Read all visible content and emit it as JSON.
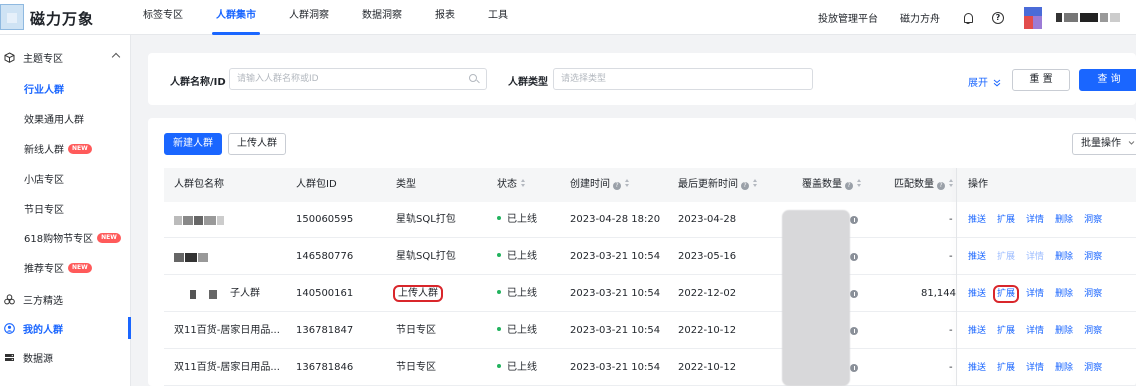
{
  "app": {
    "brand": "磁力万象",
    "nav_tabs": [
      "标签专区",
      "人群集市",
      "人群洞察",
      "数据洞察",
      "报表",
      "工具"
    ],
    "active_tab": "人群集市",
    "top_links": [
      "投放管理平台",
      "磁力方舟"
    ],
    "accent_color": "#1a66ff"
  },
  "sidebar": {
    "items": [
      {
        "label": "主题专区",
        "icon": "cube-icon",
        "type": "group",
        "expanded": true
      },
      {
        "label": "行业人群",
        "type": "sub",
        "active": true
      },
      {
        "label": "效果通用人群",
        "type": "sub"
      },
      {
        "label": "新线人群",
        "type": "sub",
        "badge": "NEW"
      },
      {
        "label": "小店专区",
        "type": "sub"
      },
      {
        "label": "节日专区",
        "type": "sub"
      },
      {
        "label": "618购物节专区",
        "type": "sub",
        "badge": "NEW"
      },
      {
        "label": "推荐专区",
        "type": "sub",
        "badge": "NEW"
      },
      {
        "label": "三方精选",
        "icon": "circles-icon",
        "type": "group"
      },
      {
        "label": "我的人群",
        "icon": "user-circle-icon",
        "type": "group",
        "active": true
      },
      {
        "label": "数据源",
        "icon": "database-icon",
        "type": "group"
      }
    ]
  },
  "filter": {
    "name_label": "人群名称/ID",
    "name_placeholder": "请输入人群名称或ID",
    "type_label": "人群类型",
    "type_placeholder": "请选择类型",
    "expand_label": "展开",
    "reset_label": "重 置",
    "query_label": "查 询"
  },
  "toolbar": {
    "new_label": "新建人群",
    "upload_label": "上传人群",
    "batch_label": "批量操作"
  },
  "table": {
    "columns": [
      "人群包名称",
      "人群包ID",
      "类型",
      "状态",
      "创建时间",
      "最后更新时间",
      "覆盖数量",
      "匹配数量",
      "操作"
    ],
    "rows": [
      {
        "name": "",
        "id": "150060595",
        "type": "星轨SQL打包",
        "status": "已上线",
        "created": "2023-04-28 18:20",
        "updated": "2023-04-28",
        "match": "-",
        "ops": [
          "推送",
          "扩展",
          "详情",
          "删除",
          "洞察"
        ],
        "disabled_ops": []
      },
      {
        "name": "",
        "id": "146580776",
        "type": "星轨SQL打包",
        "status": "已上线",
        "created": "2023-03-21 10:54",
        "updated": "2023-05-16",
        "match": "-",
        "ops": [
          "推送",
          "扩展",
          "详情",
          "删除",
          "洞察"
        ],
        "disabled_ops": [
          "扩展",
          "详情"
        ]
      },
      {
        "name": "子人群",
        "id": "140500161",
        "type": "上传人群",
        "status": "已上线",
        "created": "2023-03-21 10:54",
        "updated": "2022-12-02",
        "match": "81,144",
        "ops": [
          "推送",
          "扩展",
          "详情",
          "删除",
          "洞察"
        ],
        "disabled_ops": [],
        "highlight_type": true,
        "highlight_op": "扩展"
      },
      {
        "name": "双11百货-居家日用品...",
        "id": "136781847",
        "type": "节日专区",
        "status": "已上线",
        "created": "2023-03-21 10:54",
        "updated": "2022-10-12",
        "match": "-",
        "ops": [
          "推送",
          "扩展",
          "详情",
          "删除",
          "洞察"
        ],
        "disabled_ops": []
      },
      {
        "name": "双11百货-居家日用品...",
        "id": "136781846",
        "type": "节日专区",
        "status": "已上线",
        "created": "2023-03-21 10:54",
        "updated": "2022-10-12",
        "match": "-",
        "ops": [
          "推送",
          "扩展",
          "详情",
          "删除",
          "洞察"
        ],
        "disabled_ops": []
      }
    ]
  }
}
